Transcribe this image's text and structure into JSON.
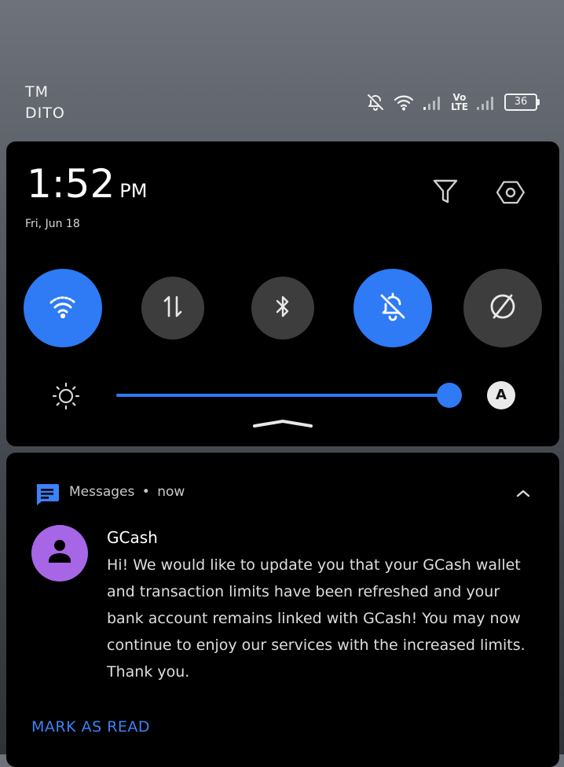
{
  "status_bar": {
    "carrier_line1": "TM",
    "carrier_line2": "DITO",
    "volte_line1": "Vo",
    "volte_line2": "LTE",
    "battery_level": "36",
    "icons": [
      "bell-off-icon",
      "wifi-icon",
      "signal-icon",
      "volte-icon",
      "signal-icon",
      "battery-icon"
    ]
  },
  "quick_settings": {
    "time": "1:52",
    "ampm": "PM",
    "date": "Fri, Jun 18",
    "toggles": [
      {
        "name": "wifi",
        "icon": "wifi-icon",
        "state": "on"
      },
      {
        "name": "mobile-data",
        "icon": "data-arrows-icon",
        "state": "off"
      },
      {
        "name": "bluetooth",
        "icon": "bluetooth-icon",
        "state": "off"
      },
      {
        "name": "silent",
        "icon": "bell-off-icon",
        "state": "on"
      },
      {
        "name": "dnd",
        "icon": "do-not-disturb-icon",
        "state": "off"
      }
    ],
    "brightness": {
      "value": 1.0,
      "auto_label": "A"
    }
  },
  "notification": {
    "app_name": "Messages",
    "separator": "•",
    "time": "now",
    "sender": "GCash",
    "message": "Hi! We would like to update you that your GCash wallet and transaction limits have been refreshed and your bank account remains linked with GCash! You may now continue to enjoy our services with the increased limits. Thank you.",
    "action_label": "MARK AS READ"
  },
  "colors": {
    "accent": "#2f7af5",
    "toggle_off": "#3d3d3d",
    "avatar": "#a766e6",
    "action": "#3b82f6"
  }
}
